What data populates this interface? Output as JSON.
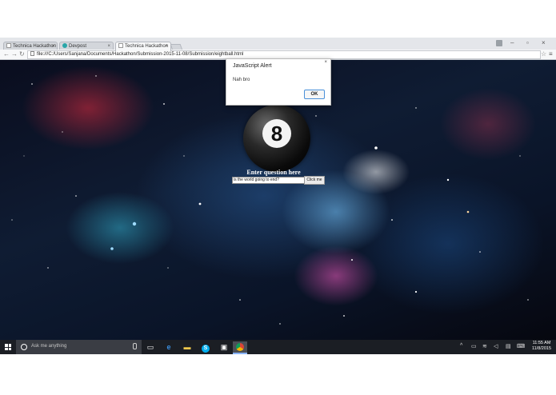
{
  "browser": {
    "tabs": [
      {
        "title": "Technica Hackathon",
        "active": false
      },
      {
        "title": "Devpost",
        "active": false
      },
      {
        "title": "Technica Hackathon",
        "active": true
      }
    ],
    "url": "file:///C:/Users/Sanjana/Documents/Hackathon/Submission-2015-11-08/Submission/eightball.html"
  },
  "page": {
    "ball_number": "8",
    "prompt": "Enter question here",
    "question_value": "is the world going to end?",
    "ask_button": "Click me"
  },
  "alert": {
    "title": "JavaScript Alert",
    "message": "Nah bro",
    "ok_label": "OK",
    "close_glyph": "×"
  },
  "taskbar": {
    "search_placeholder": "Ask me anything",
    "time": "11:55 AM",
    "date": "11/8/2015",
    "pinned": [
      "task-view-icon",
      "edge-icon",
      "file-explorer-icon",
      "skype-icon",
      "store-icon",
      "chrome-icon"
    ]
  },
  "colors": {
    "taskbar": "#1b1e24",
    "ok_border": "#4a90d9"
  }
}
